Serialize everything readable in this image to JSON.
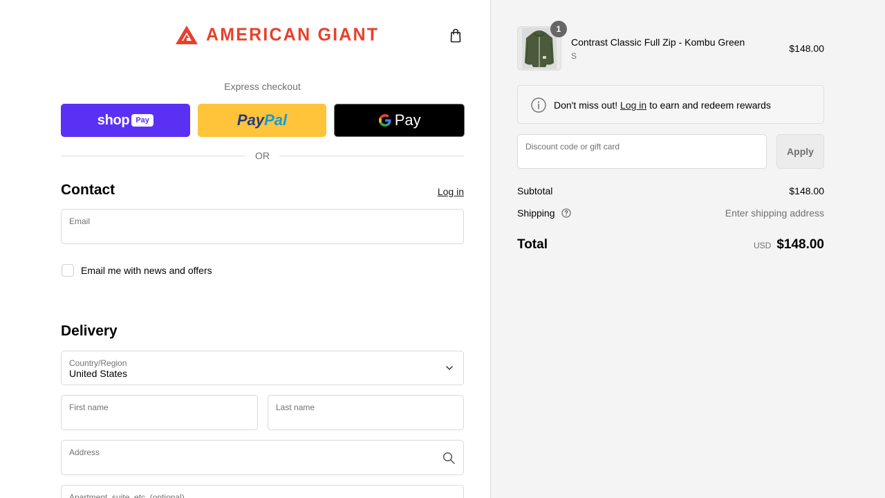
{
  "header": {
    "brand": "AMERICAN GIANT",
    "cart_icon": "shopping-bag-icon",
    "brand_color": "#e8402b"
  },
  "express": {
    "title": "Express checkout",
    "shop_pay": {
      "word": "shop",
      "tag": "Pay",
      "color": "#5a31f4"
    },
    "paypal": {
      "pay": "Pay",
      "pal": "Pal",
      "color": "#ffc439"
    },
    "gpay": {
      "word": "Pay"
    },
    "or_label": "OR"
  },
  "contact": {
    "title": "Contact",
    "login_label": "Log in",
    "email": {
      "label": "Email",
      "value": ""
    },
    "newsletter_label": "Email me with news and offers",
    "newsletter_checked": false
  },
  "delivery": {
    "title": "Delivery",
    "country": {
      "label": "Country/Region",
      "value": "United States"
    },
    "first_name": {
      "label": "First name",
      "value": ""
    },
    "last_name": {
      "label": "Last name",
      "value": ""
    },
    "address": {
      "label": "Address",
      "value": ""
    },
    "apartment": {
      "label": "Apartment, suite, etc. (optional)",
      "value": ""
    }
  },
  "summary": {
    "item": {
      "quantity": "1",
      "name": "Contrast Classic Full Zip - Kombu Green",
      "variant": "S",
      "price": "$148.00"
    },
    "rewards": {
      "prefix": "Don't miss out!",
      "login": "Log in",
      "suffix": "to earn and redeem rewards"
    },
    "discount": {
      "placeholder": "Discount code or gift card",
      "apply_label": "Apply"
    },
    "subtotal": {
      "label": "Subtotal",
      "value": "$148.00"
    },
    "shipping": {
      "label": "Shipping",
      "value": "Enter shipping address"
    },
    "total": {
      "label": "Total",
      "currency": "USD",
      "value": "$148.00"
    }
  }
}
